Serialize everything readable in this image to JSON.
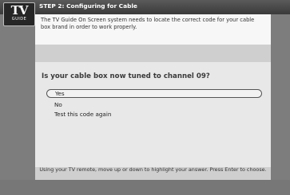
{
  "header": {
    "logo_top": "TV",
    "logo_bottom": "GUIDE",
    "step_title": "STEP 2: Configuring for Cable"
  },
  "info": {
    "text": "The TV Guide On Screen system needs to locate the correct code for your cable box brand in order to work properly."
  },
  "question": {
    "text": "Is your cable box now tuned to channel 09?"
  },
  "options": [
    {
      "label": "Yes",
      "selected": true
    },
    {
      "label": "No",
      "selected": false
    },
    {
      "label": "Test this code again",
      "selected": false
    }
  ],
  "footer": {
    "text": "Using your TV remote, move up or down to highlight your answer.  Press Enter to choose."
  },
  "colors": {
    "frame": "#7d7d7d",
    "header_bg": "#4a4a4a",
    "panel_bg": "#e8e8e8",
    "info_bg": "#f7f7f7"
  }
}
